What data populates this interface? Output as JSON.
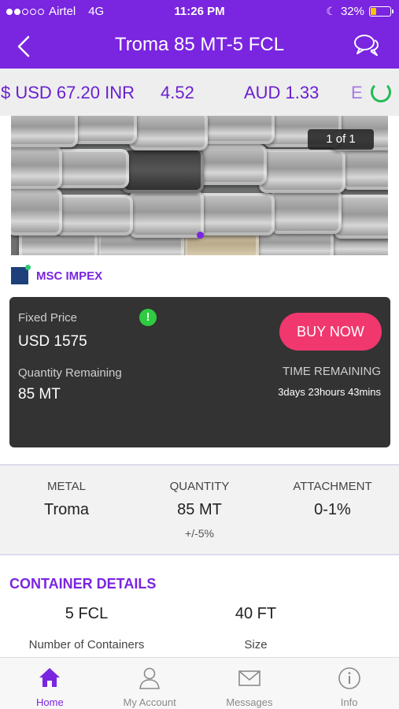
{
  "status": {
    "carrier": "Airtel",
    "network": "4G",
    "time": "11:26 PM",
    "battery": "32%",
    "battery_level": 0.32
  },
  "nav": {
    "title": "Troma 85 MT-5 FCL",
    "back_icon": "back-chevron-icon",
    "chat_icon": "chat-bubbles-icon"
  },
  "ticker": {
    "items": [
      "$ USD 67.20 INR",
      "4.52",
      "AUD 1.33",
      "E"
    ]
  },
  "gallery": {
    "counter": "1 of 1"
  },
  "seller": {
    "name": "MSC IMPEX"
  },
  "price_card": {
    "fixed_price_label": "Fixed Price",
    "fixed_price": "USD 1575",
    "buy_label": "BUY NOW",
    "quantity_label": "Quantity Remaining",
    "quantity": "85 MT",
    "time_label": "TIME REMAINING",
    "time": "3days 23hours 43mins"
  },
  "specs": [
    {
      "header": "METAL",
      "value": "Troma",
      "sub": ""
    },
    {
      "header": "QUANTITY",
      "value": "85 MT",
      "sub": "+/-5%"
    },
    {
      "header": "ATTACHMENT",
      "value": "0-1%",
      "sub": ""
    }
  ],
  "container": {
    "title": "CONTAINER DETAILS",
    "containers_value": "5 FCL",
    "containers_label": "Number of Containers",
    "size_value": "40 FT",
    "size_label": "Size"
  },
  "tabs": [
    {
      "label": "Home",
      "icon": "home-icon"
    },
    {
      "label": "My Account",
      "icon": "user-icon"
    },
    {
      "label": "Messages",
      "icon": "envelope-icon"
    },
    {
      "label": "Info",
      "icon": "info-icon"
    }
  ],
  "colors": {
    "brand": "#7a25e0",
    "buy": "#f0386e",
    "card": "#333333",
    "spinner": "#22bb55"
  }
}
